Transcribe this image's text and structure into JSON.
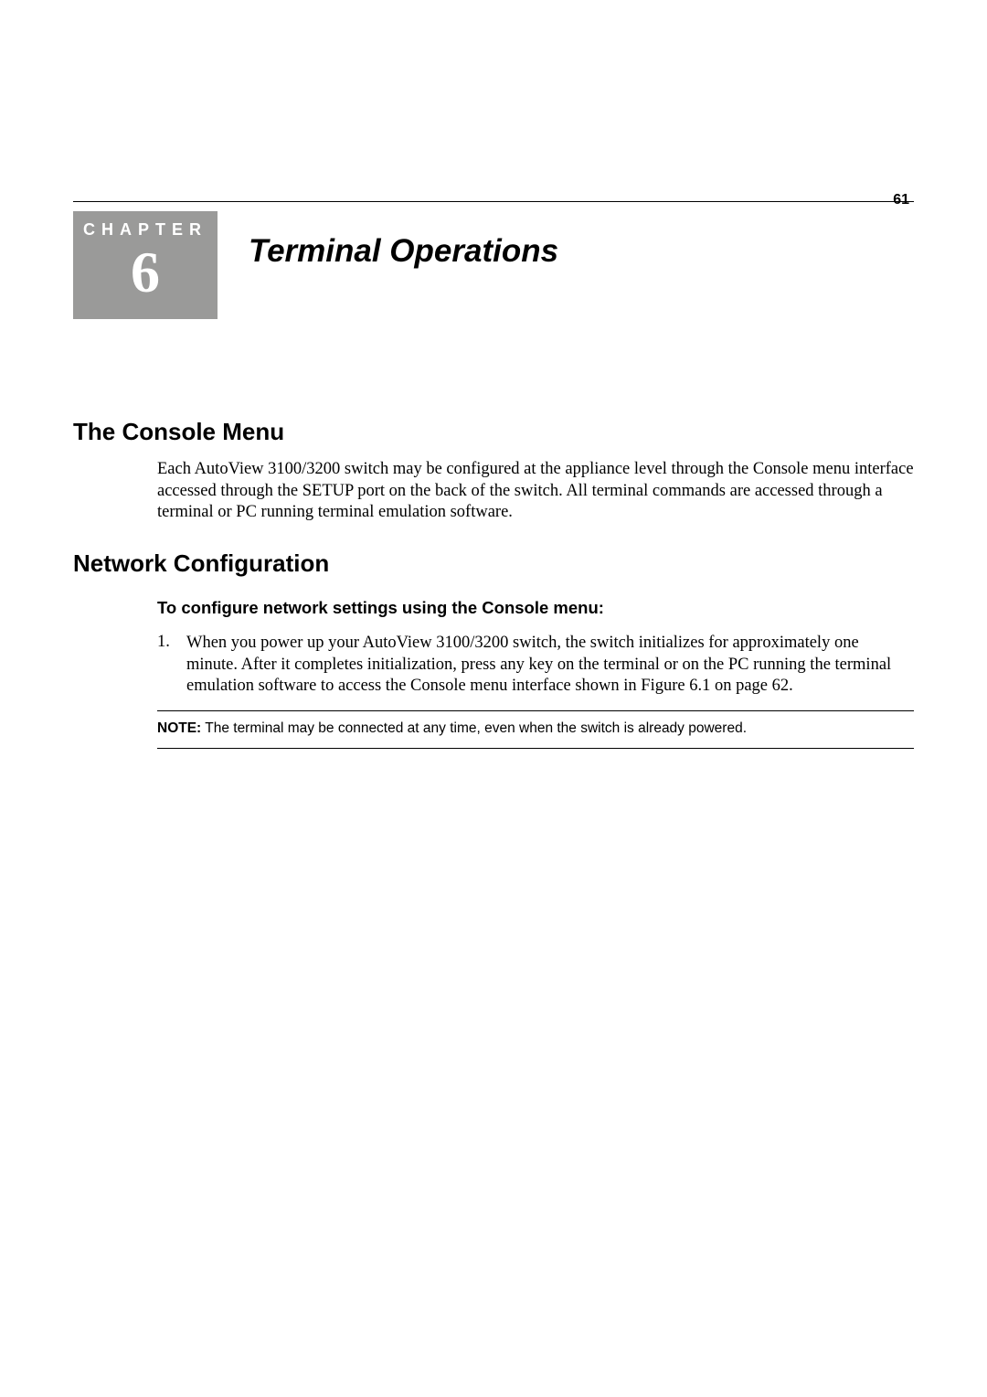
{
  "page_number": "61",
  "chapter": {
    "label": "CHAPTER",
    "number": "6",
    "title": "Terminal Operations"
  },
  "sections": {
    "console_menu": {
      "heading": "The Console Menu",
      "para": "Each AutoView 3100/3200 switch may be configured at the appliance level through the Console menu interface accessed through the SETUP port on the back of the switch. All terminal commands are accessed through a terminal or PC running terminal emulation software."
    },
    "network_config": {
      "heading": "Network Configuration",
      "subheading": "To configure network settings using the Console menu:",
      "step1_number": "1.",
      "step1_text": "When you power up your AutoView 3100/3200 switch, the switch initializes for approximately one minute. After it completes initialization, press any key on the terminal or on the PC running the terminal emulation software to access the Console menu interface shown in Figure 6.1 on page 62.",
      "note_label": "NOTE:",
      "note_text": " The terminal may be connected at any time, even when the switch is already powered."
    }
  }
}
